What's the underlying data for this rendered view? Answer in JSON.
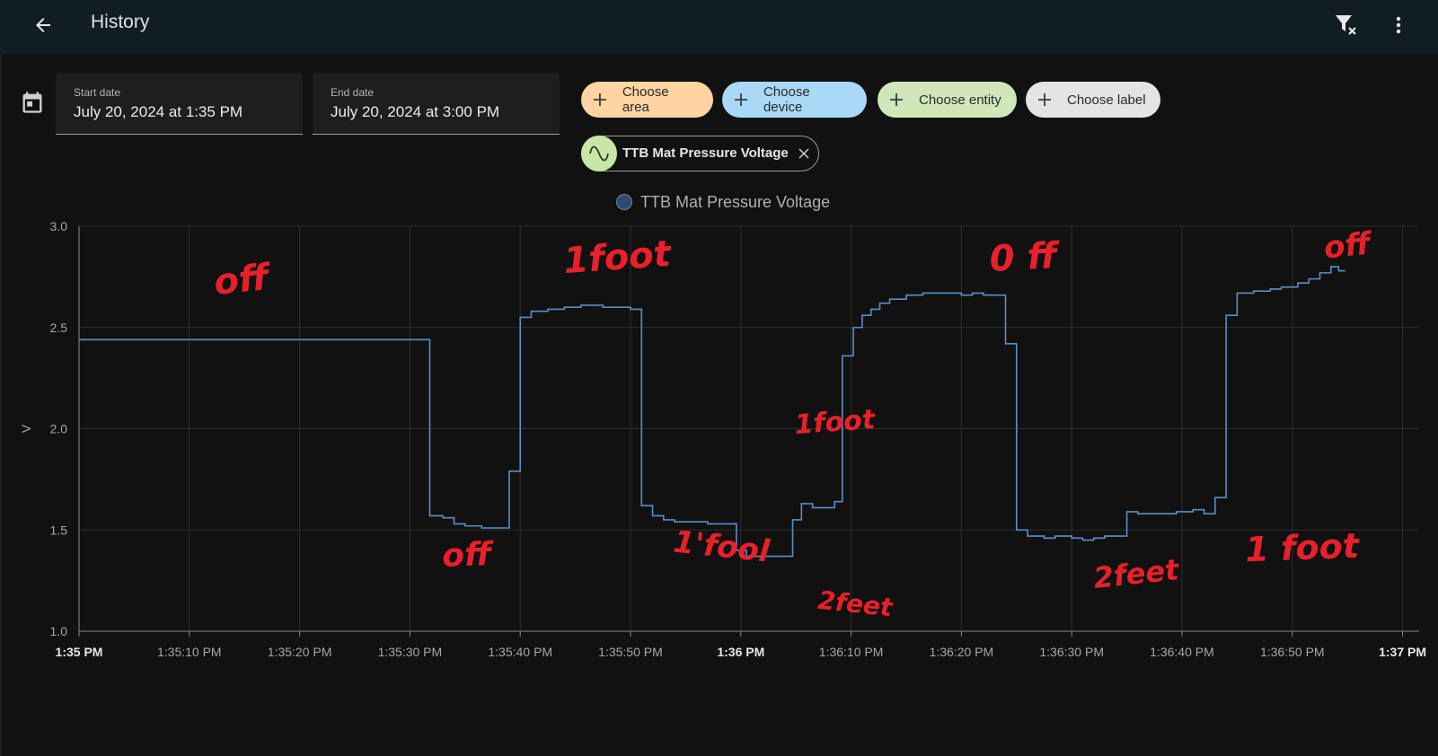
{
  "header": {
    "title": "History",
    "back_icon": "arrow-left-icon",
    "filter_clear_icon": "filter-remove-icon",
    "more_icon": "dots-vertical-icon",
    "background": "#101e24"
  },
  "date_range": {
    "calendar_icon": "calendar-icon",
    "start": {
      "label": "Start date",
      "value": "July 20, 2024 at 1:35 PM"
    },
    "end": {
      "label": "End date",
      "value": "July 20, 2024 at 3:00 PM"
    }
  },
  "pickers": [
    {
      "label": "Choose area",
      "color": "#fdd4a2"
    },
    {
      "label": "Choose device",
      "color": "#a9d9f7"
    },
    {
      "label": "Choose entity",
      "color": "#cfe7b9"
    },
    {
      "label": "Choose label",
      "color": "#e4e4e4"
    }
  ],
  "selected_entity": {
    "name": "TTB Mat Pressure Voltage",
    "icon": "sine-wave-icon",
    "remove_icon": "close-icon"
  },
  "chart_data": {
    "type": "line",
    "step": true,
    "xlabel": "",
    "ylabel": "V",
    "ylim": [
      1.0,
      3.0
    ],
    "yticks": [
      "1.0",
      "1.5",
      "2.0",
      "2.5",
      "3.0"
    ],
    "xticks": [
      "1:35 PM",
      "1:35:10 PM",
      "1:35:20 PM",
      "1:35:30 PM",
      "1:35:40 PM",
      "1:35:50 PM",
      "1:36 PM",
      "1:36:10 PM",
      "1:36:20 PM",
      "1:36:30 PM",
      "1:36:40 PM",
      "1:36:50 PM",
      "1:37 PM"
    ],
    "xticks_bold": [
      "1:35 PM",
      "1:36 PM",
      "1:37 PM"
    ],
    "xlim_seconds": [
      0,
      61
    ],
    "grid": true,
    "legend": "top-center",
    "series": [
      {
        "name": "TTB Mat Pressure Voltage",
        "color": "#5a8fc7",
        "points": [
          [
            0,
            2.44
          ],
          [
            31.8,
            1.57
          ],
          [
            33,
            1.56
          ],
          [
            34,
            1.53
          ],
          [
            35,
            1.52
          ],
          [
            36.5,
            1.51
          ],
          [
            38,
            1.51
          ],
          [
            39,
            1.79
          ],
          [
            40,
            2.55
          ],
          [
            41,
            2.58
          ],
          [
            42.5,
            2.59
          ],
          [
            44,
            2.6
          ],
          [
            45.5,
            2.61
          ],
          [
            47.5,
            2.6
          ],
          [
            50,
            2.59
          ],
          [
            51,
            1.62
          ],
          [
            52,
            1.57
          ],
          [
            53,
            1.55
          ],
          [
            54,
            1.54
          ],
          [
            55.5,
            1.54
          ],
          [
            57,
            1.53
          ],
          [
            58,
            1.53
          ],
          [
            59.6,
            1.4
          ],
          [
            60.5,
            1.37
          ],
          [
            62.2,
            1.37
          ],
          [
            63.8,
            1.37
          ],
          [
            64.7,
            1.55
          ],
          [
            65.5,
            1.63
          ],
          [
            66.5,
            1.61
          ],
          [
            68.5,
            1.64
          ],
          [
            69.2,
            2.36
          ],
          [
            70.2,
            2.5
          ],
          [
            71,
            2.56
          ],
          [
            71.8,
            2.59
          ],
          [
            72.6,
            2.62
          ],
          [
            73.5,
            2.64
          ],
          [
            75,
            2.66
          ],
          [
            76.5,
            2.67
          ],
          [
            78.5,
            2.67
          ],
          [
            80,
            2.66
          ],
          [
            81,
            2.67
          ],
          [
            82,
            2.66
          ],
          [
            84,
            2.42
          ],
          [
            85,
            1.5
          ],
          [
            86,
            1.47
          ],
          [
            87.5,
            1.46
          ],
          [
            88.5,
            1.47
          ],
          [
            90,
            1.46
          ],
          [
            91,
            1.45
          ],
          [
            92,
            1.46
          ],
          [
            93,
            1.47
          ],
          [
            95,
            1.59
          ],
          [
            96,
            1.58
          ],
          [
            98,
            1.58
          ],
          [
            99.5,
            1.59
          ],
          [
            101,
            1.6
          ],
          [
            102,
            1.58
          ],
          [
            103,
            1.66
          ],
          [
            104,
            2.56
          ],
          [
            105,
            2.67
          ],
          [
            106.5,
            2.68
          ],
          [
            108,
            2.69
          ],
          [
            109,
            2.7
          ],
          [
            110.5,
            2.72
          ],
          [
            111.5,
            2.74
          ],
          [
            112.5,
            2.77
          ],
          [
            113.5,
            2.8
          ],
          [
            114.2,
            2.78
          ]
        ]
      }
    ],
    "annotations": [
      "off",
      "1foot",
      "off",
      "1'fool",
      "2feet",
      "1foot",
      "0 ff",
      "2feet",
      "1 foot",
      "off"
    ]
  }
}
